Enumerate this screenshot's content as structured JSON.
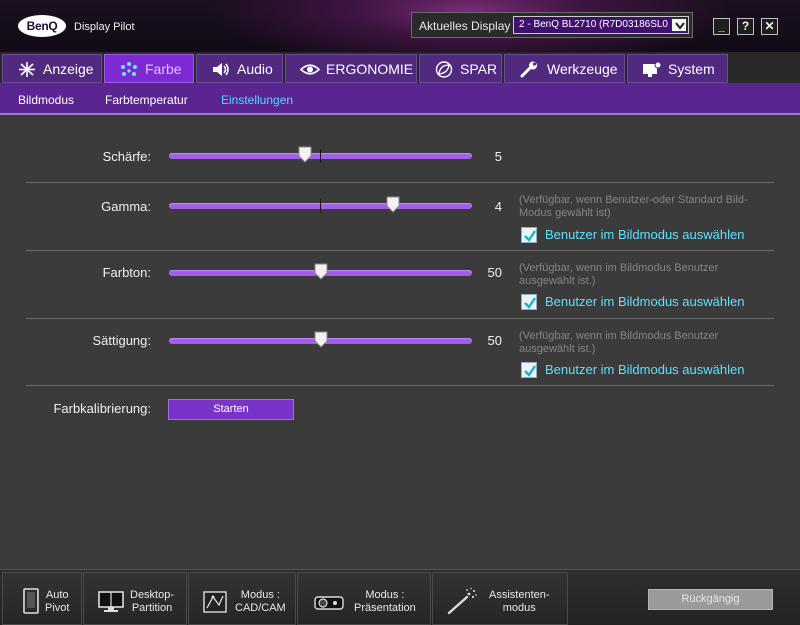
{
  "window": {
    "brand": "BenQ",
    "title": "Display Pilot",
    "current_display_label": "Aktuelles Display",
    "current_display_value": "2 - BenQ BL2710 (R7D03186SL0 )",
    "minimize": "_",
    "help": "?",
    "close": "✕"
  },
  "tabs": [
    {
      "label": "Anzeige",
      "icon": "sparkle-icon",
      "active": false
    },
    {
      "label": "Farbe",
      "icon": "color-dots-icon",
      "active": true
    },
    {
      "label": "Audio",
      "icon": "speaker-icon",
      "active": false
    },
    {
      "label": "ERGONOMIE",
      "icon": "eye-icon",
      "active": false
    },
    {
      "label": "SPAR",
      "icon": "leaf-icon",
      "active": false
    },
    {
      "label": "Werkzeuge",
      "icon": "wrench-icon",
      "active": false
    },
    {
      "label": "System",
      "icon": "monitor-gear-icon",
      "active": false
    }
  ],
  "subtabs": [
    {
      "label": "Bildmodus",
      "active": false
    },
    {
      "label": "Farbtemperatur",
      "active": false
    },
    {
      "label": "Einstellungen",
      "active": true
    }
  ],
  "settings": {
    "schaerfe": {
      "label": "Schärfe:",
      "value": "5",
      "level": 0.45
    },
    "gamma": {
      "label": "Gamma:",
      "value": "4",
      "level": 0.74,
      "note": "(Verfügbar, wenn Benutzer-oder Standard Bild-Modus gewählt ist)",
      "checkbox": "Benutzer im Bildmodus auswählen"
    },
    "farbton": {
      "label": "Farbton:",
      "value": "50",
      "level": 0.5,
      "note": "(Verfügbar, wenn im Bildmodus Benutzer ausgewählt ist.)",
      "checkbox": "Benutzer im Bildmodus auswählen"
    },
    "saettigung": {
      "label": "Sättigung:",
      "value": "50",
      "level": 0.5,
      "note": "(Verfügbar, wenn im Bildmodus Benutzer ausgewählt ist.)",
      "checkbox": "Benutzer im Bildmodus auswählen"
    },
    "farbkalibrierung": {
      "label": "Farbkalibrierung:",
      "button": "Starten"
    }
  },
  "bottom": [
    {
      "label": "Auto\nPivot",
      "icon": "phone-portrait-icon"
    },
    {
      "label": "Desktop-\nPartition",
      "icon": "monitor-split-icon"
    },
    {
      "label": "Modus :\nCAD/CAM",
      "icon": "cad-icon"
    },
    {
      "label": "Modus :\nPräsentation",
      "icon": "projector-icon"
    },
    {
      "label": "Assistenten-\nmodus",
      "icon": "magic-wand-icon"
    }
  ],
  "undo": "Rückgängig",
  "colors": {
    "accent": "#7e2ad2",
    "subbar": "#5b2591",
    "link": "#4fd8ff"
  }
}
